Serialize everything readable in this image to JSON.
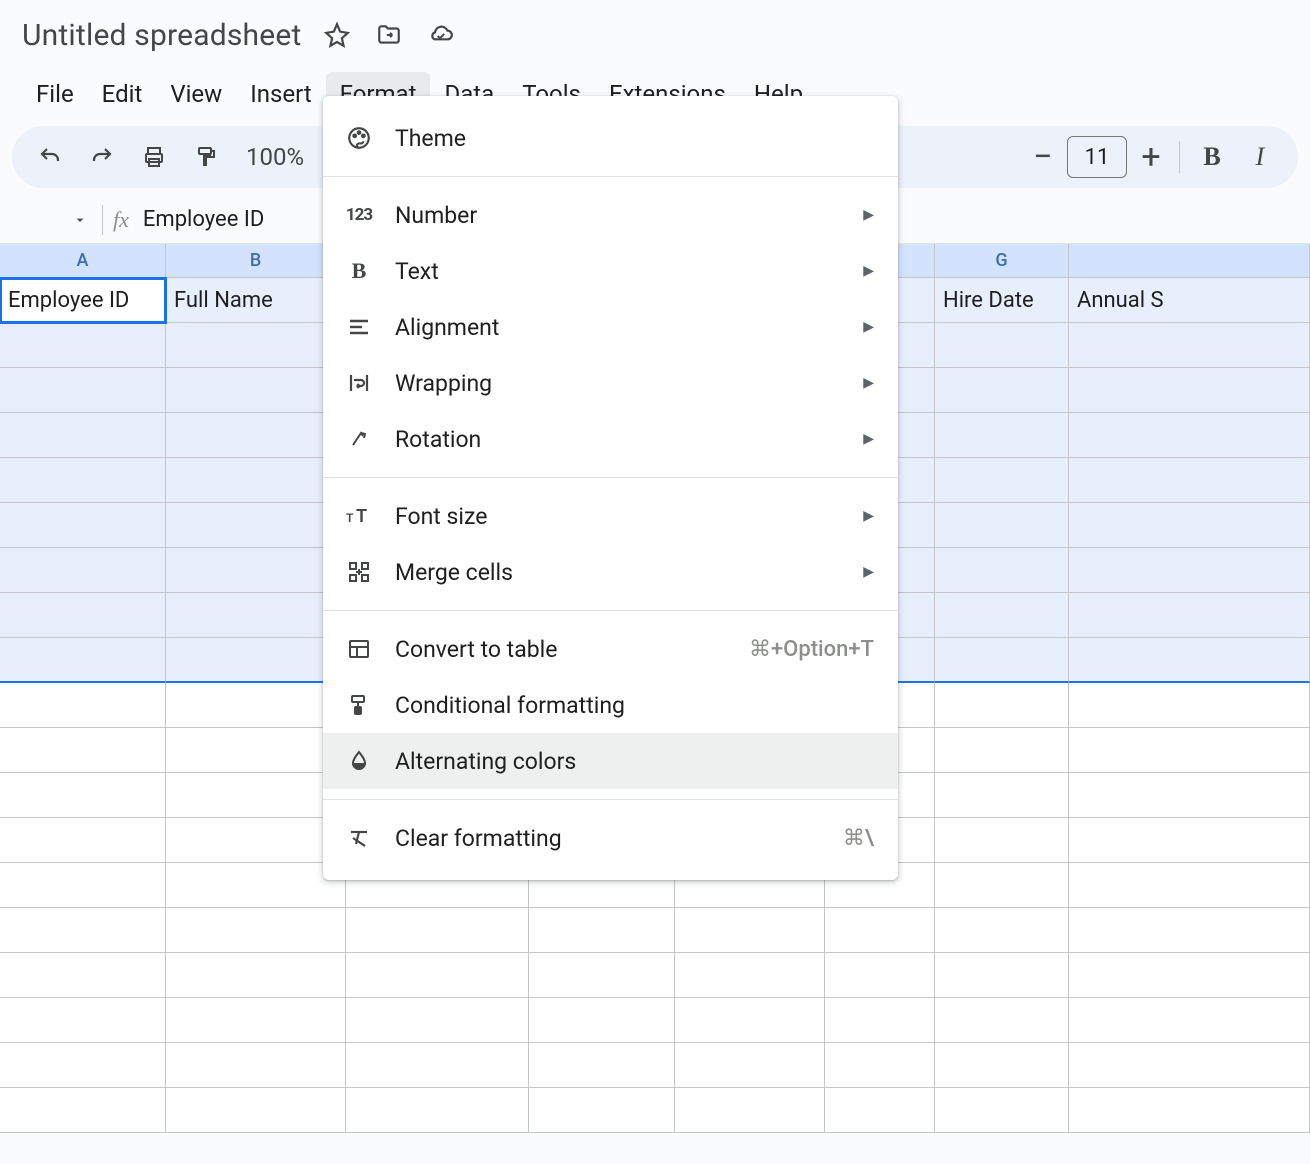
{
  "doc": {
    "title": "Untitled spreadsheet"
  },
  "menubar": [
    "File",
    "Edit",
    "View",
    "Insert",
    "Format",
    "Data",
    "Tools",
    "Extensions",
    "Help"
  ],
  "menubar_active_index": 4,
  "toolbar": {
    "zoom": "100%",
    "font_size": "11"
  },
  "formula_bar": {
    "content": "Employee ID"
  },
  "columns": {
    "headers": [
      "A",
      "B",
      "",
      "",
      "",
      "",
      "G",
      ""
    ],
    "row1": [
      "Employee ID",
      "Full Name",
      "",
      "",
      "",
      "",
      "Hire Date",
      "Annual S"
    ]
  },
  "selected_row_count": 9,
  "unselected_row_count": 10,
  "dropdown": {
    "items": [
      {
        "icon": "palette",
        "label": "Theme",
        "type": "item"
      },
      {
        "type": "separator"
      },
      {
        "icon": "number",
        "label": "Number",
        "submenu": true,
        "type": "item"
      },
      {
        "icon": "bold",
        "label": "Text",
        "submenu": true,
        "type": "item"
      },
      {
        "icon": "align",
        "label": "Alignment",
        "submenu": true,
        "type": "item"
      },
      {
        "icon": "wrap",
        "label": "Wrapping",
        "submenu": true,
        "type": "item"
      },
      {
        "icon": "rotate",
        "label": "Rotation",
        "submenu": true,
        "type": "item"
      },
      {
        "type": "separator"
      },
      {
        "icon": "fontsize",
        "label": "Font size",
        "submenu": true,
        "type": "item"
      },
      {
        "icon": "merge",
        "label": "Merge cells",
        "submenu": true,
        "type": "item"
      },
      {
        "type": "separator"
      },
      {
        "icon": "table",
        "label": "Convert to table",
        "shortcut": "⌘+Option+T",
        "type": "item"
      },
      {
        "icon": "cond",
        "label": "Conditional formatting",
        "type": "item"
      },
      {
        "icon": "alt",
        "label": "Alternating colors",
        "hovered": true,
        "type": "item"
      },
      {
        "type": "separator"
      },
      {
        "icon": "clear",
        "label": "Clear formatting",
        "shortcut": "⌘\\",
        "type": "item"
      }
    ]
  }
}
